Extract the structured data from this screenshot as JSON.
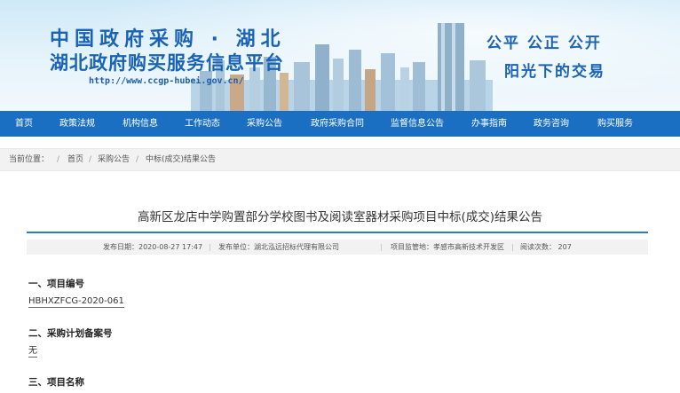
{
  "banner": {
    "title_line1": "中国政府采购 · 湖北",
    "title_line2": "湖北政府购买服务信息平台",
    "url": "http://www.ccgp-hubei.gov.cn/",
    "slogan_line1": "公平  公正  公开",
    "slogan_line2": "阳光下的交易"
  },
  "nav": {
    "items": [
      "首页",
      "政策法规",
      "机构信息",
      "工作动态",
      "采购公告",
      "政府采购合同",
      "监督信息公告",
      "办事指南",
      "政务咨询",
      "购买服务"
    ]
  },
  "breadcrumb": {
    "label": "当前位置：",
    "items": [
      "首页",
      "采购公告",
      "中标(成交)结果公告"
    ],
    "separator": "/"
  },
  "article": {
    "title": "高新区龙店中学购置部分学校图书及阅读室器材采购项目中标(成交)结果公告",
    "meta": {
      "publish_date": "发布日期：2020-08-27 17:47",
      "publisher": "发布单位：湖北泓远招标代理有限公司",
      "supervision": "项目监管地：孝感市高新技术开发区",
      "views": "阅读次数： 207"
    },
    "sections": [
      {
        "heading": "一、项目编号",
        "value": "HBHXZFCG-2020-061"
      },
      {
        "heading": "二、采购计划备案号",
        "value": "无"
      },
      {
        "heading": "三、项目名称",
        "value": ""
      }
    ]
  },
  "colors": {
    "nav_bg": "#1b6fc2",
    "banner_text": "#1a63b4",
    "accent_line": "#2a7cc7"
  }
}
